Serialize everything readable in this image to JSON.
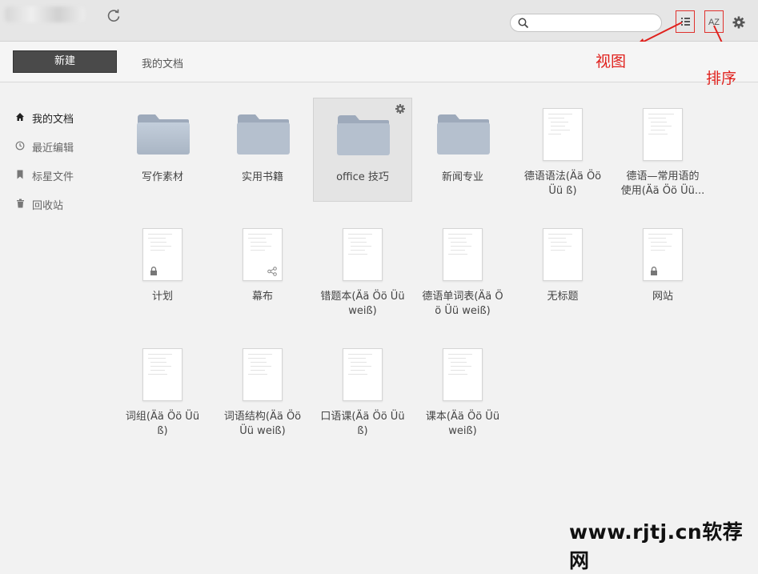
{
  "header": {
    "search_placeholder": "",
    "sort_label": "AZ"
  },
  "toolbar": {
    "new_button": "新建",
    "breadcrumb": "我的文档"
  },
  "annotations": {
    "view": "视图",
    "sort": "排序",
    "color": "#e0201c"
  },
  "sidebar": {
    "items": [
      {
        "label": "我的文档",
        "icon": "home-icon"
      },
      {
        "label": "最近编辑",
        "icon": "clock-icon"
      },
      {
        "label": "标星文件",
        "icon": "bookmark-icon"
      },
      {
        "label": "回收站",
        "icon": "trash-icon"
      }
    ]
  },
  "items": [
    {
      "type": "folder",
      "name": "写作素材"
    },
    {
      "type": "folder",
      "name": "实用书籍"
    },
    {
      "type": "folder",
      "name": "office 技巧",
      "selected": true
    },
    {
      "type": "folder",
      "name": "新闻专业"
    },
    {
      "type": "doc",
      "name_line1": "德语语法(Ää Öö",
      "name_line2": "Üü ß)"
    },
    {
      "type": "doc",
      "name_line1": "德语—常用语的",
      "name_line2": "使用(Ää Öö Üü..."
    },
    {
      "type": "doc",
      "name": "计划",
      "badge": "lock-icon"
    },
    {
      "type": "doc",
      "name": "幕布",
      "badge": "share-icon"
    },
    {
      "type": "doc",
      "name_line1": "错题本(Ää Öö Üü",
      "name_line2": "weiß)"
    },
    {
      "type": "doc",
      "name_line1": "德语单词表(Ää Ö",
      "name_line2": "ö Üü weiß)"
    },
    {
      "type": "doc",
      "name": "无标题"
    },
    {
      "type": "doc",
      "name": "网站",
      "badge": "lock-icon"
    },
    {
      "type": "doc",
      "name_line1": "词组(Ää Öö Üü",
      "name_line2": "ß)"
    },
    {
      "type": "doc",
      "name_line1": "词语结构(Ää Öö",
      "name_line2": "Üü weiß)"
    },
    {
      "type": "doc",
      "name_line1": "口语课(Ää Öö Üü",
      "name_line2": "ß)"
    },
    {
      "type": "doc",
      "name_line1": "课本(Ää Öö Üü",
      "name_line2": "weiß)"
    }
  ],
  "watermark": "www.rjtj.cn软荐网"
}
